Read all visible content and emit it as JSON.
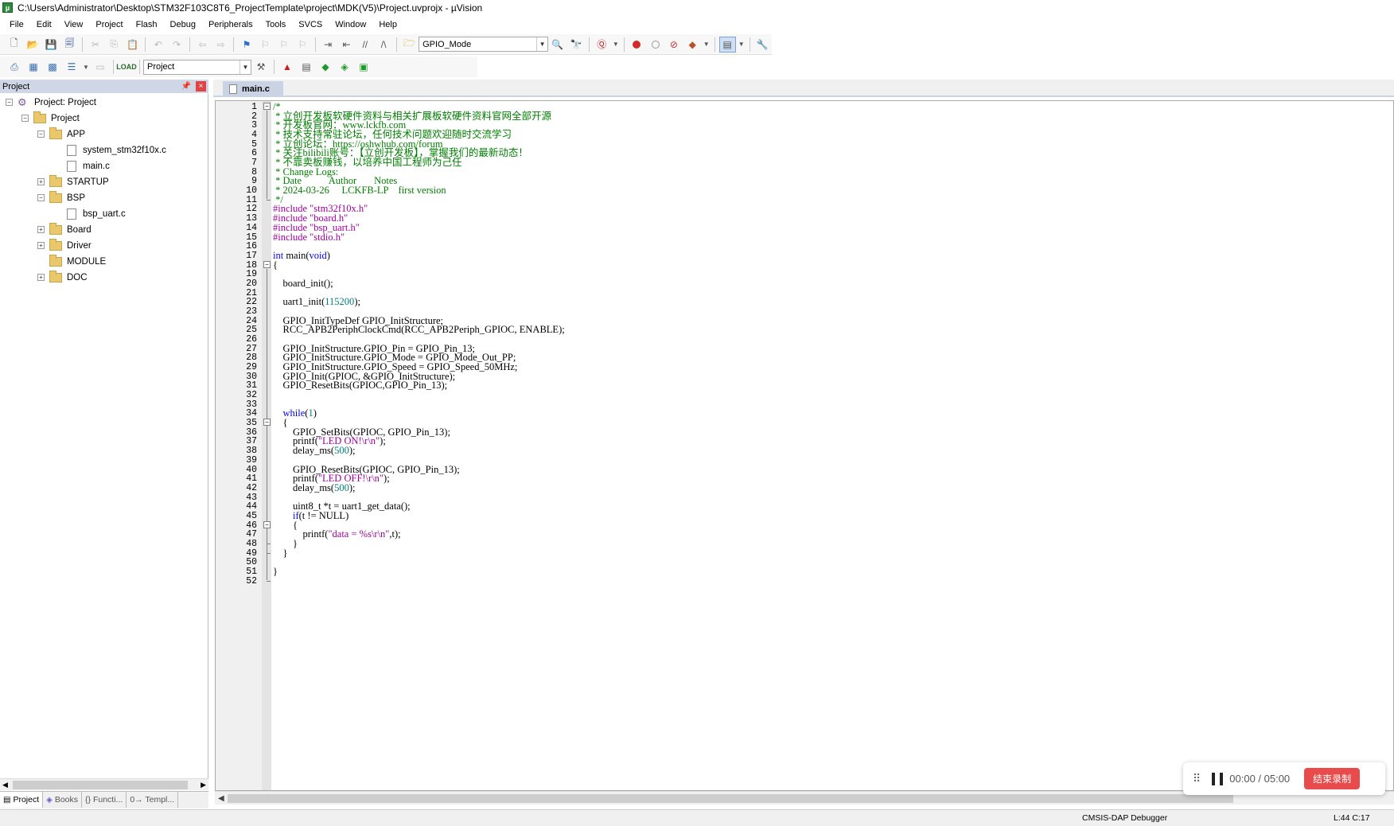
{
  "window": {
    "title": "C:\\Users\\Administrator\\Desktop\\STM32F103C8T6_ProjectTemplate\\project\\MDK(V5)\\Project.uvprojx - µVision"
  },
  "menu": [
    "File",
    "Edit",
    "View",
    "Project",
    "Flash",
    "Debug",
    "Peripherals",
    "Tools",
    "SVCS",
    "Window",
    "Help"
  ],
  "toolbar1": {
    "find_combo": "GPIO_Mode"
  },
  "toolbar2": {
    "target_combo": "Project"
  },
  "project_pane": {
    "title": "Project",
    "pin_icon": "pin-icon",
    "close_label": "×",
    "tree": [
      {
        "label": "Project: Project",
        "type": "root"
      },
      {
        "label": "Project",
        "type": "target"
      },
      {
        "label": "APP",
        "type": "group"
      },
      {
        "label": "system_stm32f10x.c",
        "type": "file"
      },
      {
        "label": "main.c",
        "type": "file"
      },
      {
        "label": "STARTUP",
        "type": "group"
      },
      {
        "label": "BSP",
        "type": "group"
      },
      {
        "label": "bsp_uart.c",
        "type": "file"
      },
      {
        "label": "Board",
        "type": "group"
      },
      {
        "label": "Driver",
        "type": "group"
      },
      {
        "label": "MODULE",
        "type": "group"
      },
      {
        "label": "DOC",
        "type": "group"
      }
    ],
    "bottom_tabs": [
      {
        "label": "Project",
        "icon": "project-icon"
      },
      {
        "label": "Books",
        "icon": "books-icon"
      },
      {
        "label": "{} Functi...",
        "icon": "functions-icon"
      },
      {
        "label": "0→ Templ...",
        "icon": "templates-icon"
      }
    ]
  },
  "editor": {
    "tab_label": "main.c",
    "lines": [
      "/*",
      " * 立创开发板软硬件资料与相关扩展板软硬件资料官网全部开源",
      " * 开发板官网：www.lckfb.com",
      " * 技术支持常驻论坛，任何技术问题欢迎随时交流学习",
      " * 立创论坛：https://oshwhub.com/forum",
      " * 关注bilibili账号：【立创开发板】，掌握我们的最新动态！",
      " * 不靠卖板赚钱，以培养中国工程师为己任",
      " * Change Logs:",
      " * Date           Author       Notes",
      " * 2024-03-26     LCKFB-LP    first version",
      " */",
      "#include \"stm32f10x.h\"",
      "#include \"board.h\"",
      "#include \"bsp_uart.h\"",
      "#include \"stdio.h\"",
      "",
      "int main(void)",
      "{",
      "",
      "    board_init();",
      "",
      "    uart1_init(115200);",
      "",
      "    GPIO_InitTypeDef GPIO_InitStructure;",
      "    RCC_APB2PeriphClockCmd(RCC_APB2Periph_GPIOC, ENABLE);",
      "",
      "    GPIO_InitStructure.GPIO_Pin = GPIO_Pin_13;",
      "    GPIO_InitStructure.GPIO_Mode = GPIO_Mode_Out_PP;",
      "    GPIO_InitStructure.GPIO_Speed = GPIO_Speed_50MHz;",
      "    GPIO_Init(GPIOC, &GPIO_InitStructure);",
      "    GPIO_ResetBits(GPIOC,GPIO_Pin_13);",
      "",
      "",
      "    while(1)",
      "    {",
      "        GPIO_SetBits(GPIOC, GPIO_Pin_13);",
      "        printf(\"LED ON!\\r\\n\");",
      "        delay_ms(500);",
      "",
      "        GPIO_ResetBits(GPIOC, GPIO_Pin_13);",
      "        printf(\"LED OFF!\\r\\n\");",
      "        delay_ms(500);",
      "",
      "        uint8_t *t = uart1_get_data();",
      "        if(t != NULL)",
      "        {",
      "            printf(\"data = %s\\r\\n\",t);",
      "        }",
      "    }",
      "",
      "}",
      ""
    ]
  },
  "status": {
    "debugger": "CMSIS-DAP Debugger",
    "position": "L:44 C:17"
  },
  "recorder": {
    "time": "00:00 / 05:00",
    "stop_label": "结束录制"
  },
  "colors": {
    "comment": "#008000",
    "preprocessor": "#a000a0",
    "keyword": "#0000ff",
    "number": "#008080",
    "accent": "#c9d3e4",
    "stop_button": "#e84b4b"
  }
}
